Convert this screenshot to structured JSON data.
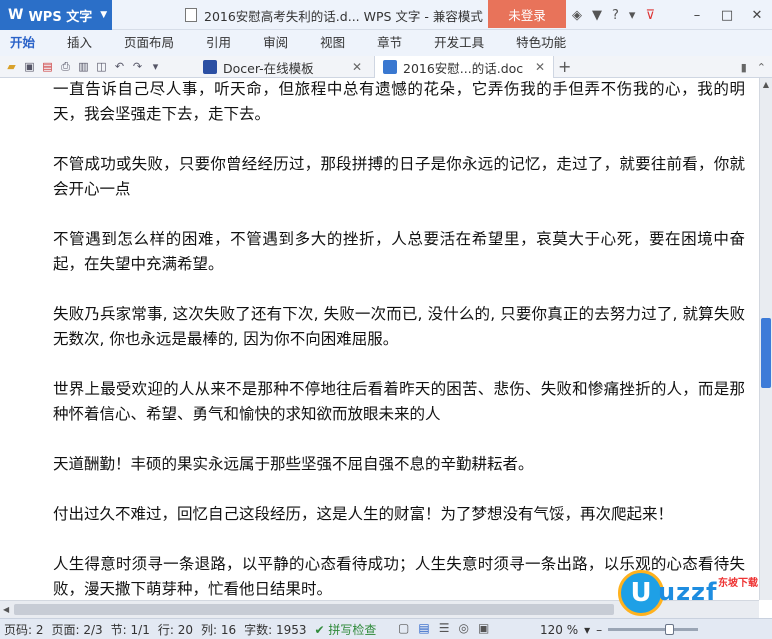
{
  "app": {
    "name": "WPS 文字",
    "logo": "W"
  },
  "window": {
    "title": "2016安慰高考失利的话.d... WPS 文字 - 兼容模式",
    "login_label": "未登录"
  },
  "menu": {
    "tabs": [
      "开始",
      "插入",
      "页面布局",
      "引用",
      "审阅",
      "视图",
      "章节",
      "开发工具",
      "特色功能"
    ],
    "active_index": 0
  },
  "doc_tabs": [
    {
      "label": "Docer-在线模板",
      "color": "#2b4fa3"
    },
    {
      "label": "2016安慰...的话.doc",
      "color": "#3a78d0"
    }
  ],
  "document": {
    "paragraphs": [
      "一直告诉自己尽人事，听天命，但旅程中总有遗憾的花朵，它弄伤我的手但弄不伤我的心，我的明天，我会坚强走下去，走下去。",
      "不管成功或失败，只要你曾经经历过，那段拼搏的日子是你永远的记忆，走过了，就要往前看，你就会开心一点",
      "不管遇到怎么样的困难，不管遇到多大的挫折，人总要活在希望里，哀莫大于心死，要在困境中奋起，在失望中充满希望。",
      "失败乃兵家常事, 这次失败了还有下次, 失败一次而已, 没什么的, 只要你真正的去努力过了, 就算失败无数次, 你也永远是最棒的, 因为你不向困难屈服。",
      "世界上最受欢迎的人从来不是那种不停地往后看着昨天的困苦、悲伤、失败和惨痛挫折的人，而是那种怀着信心、希望、勇气和愉快的求知欲而放眼未来的人",
      "天道酬勤！丰硕的果实永远属于那些坚强不屈自强不息的辛勤耕耘者。",
      "付出过久不难过，回忆自己这段经历，这是人生的财富！为了梦想没有气馁，再次爬起来！",
      "人生得意时须寻一条退路，以平静的心态看待成功；人生失意时须寻一条出路，以乐观的心态看待失败，漫天撒下萌芽种，忙看他日结果时。"
    ]
  },
  "status": {
    "page_num": "页码: 2",
    "pages": "页面: 2/3",
    "section": "节: 1/1",
    "row": "行: 20",
    "col": "列: 16",
    "word_count": "字数: 1953",
    "spell_check": "拼写检查",
    "zoom": "120 %",
    "zoom_fraction": 0.7
  },
  "watermark": {
    "text": "uzzf",
    "sub": "东坡下载",
    "circle": "U"
  }
}
